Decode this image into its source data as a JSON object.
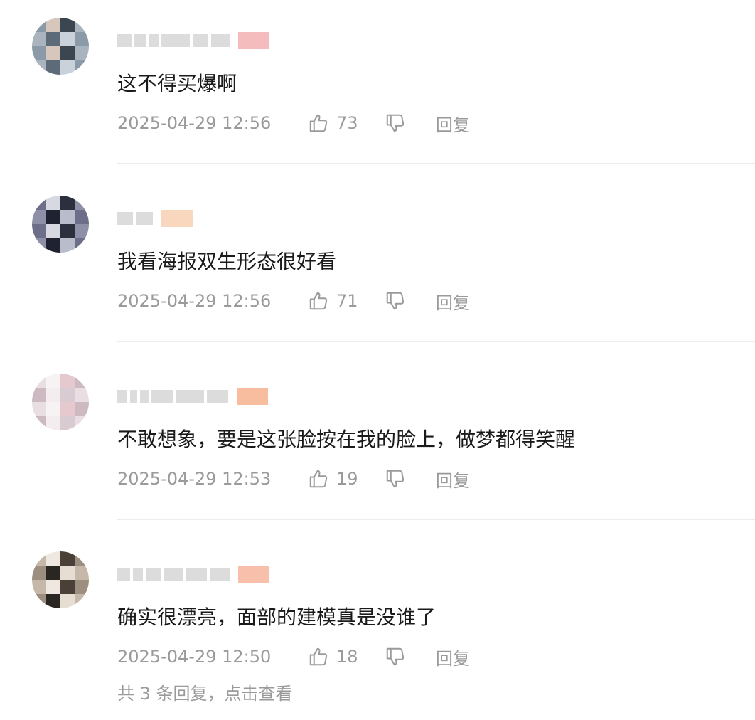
{
  "comments": [
    {
      "text": "这不得买爆啊",
      "time": "2025-04-29 12:56",
      "likes": "73",
      "reply_label": "回复",
      "badge_color": "#f0a6a6",
      "avatar_colors": [
        "#8a9aa8",
        "#c9d2da",
        "#5d6b78",
        "#a9b4bf",
        "#3c4650",
        "#d6c6bb"
      ]
    },
    {
      "text": "我看海报双生形态很好看",
      "time": "2025-04-29 12:56",
      "likes": "71",
      "reply_label": "回复",
      "badge_color": "#f7c9a8",
      "avatar_colors": [
        "#6d6f8a",
        "#b9bccb",
        "#1f2230",
        "#8d90a6",
        "#2c2f3d",
        "#d8d8e2"
      ]
    },
    {
      "text": "不敢想象，要是这张脸按在我的脸上，做梦都得笑醒",
      "time": "2025-04-29 12:53",
      "likes": "19",
      "reply_label": "回复",
      "badge_color": "#f4a77e",
      "avatar_colors": [
        "#e9dfe3",
        "#d8cbd1",
        "#f3edf0",
        "#cdb9c1",
        "#e6c9cf",
        "#f7f2f4"
      ]
    },
    {
      "text": "确实很漂亮，面部的建模真是没谁了",
      "time": "2025-04-29 12:50",
      "likes": "18",
      "reply_label": "回复",
      "badge_color": "#f6ab8e",
      "avatar_colors": [
        "#c6b8a8",
        "#e6ddd3",
        "#2a2622",
        "#9d8f80",
        "#4a4038",
        "#efe8e0"
      ]
    }
  ],
  "more_replies": "共 3 条回复，点击查看"
}
